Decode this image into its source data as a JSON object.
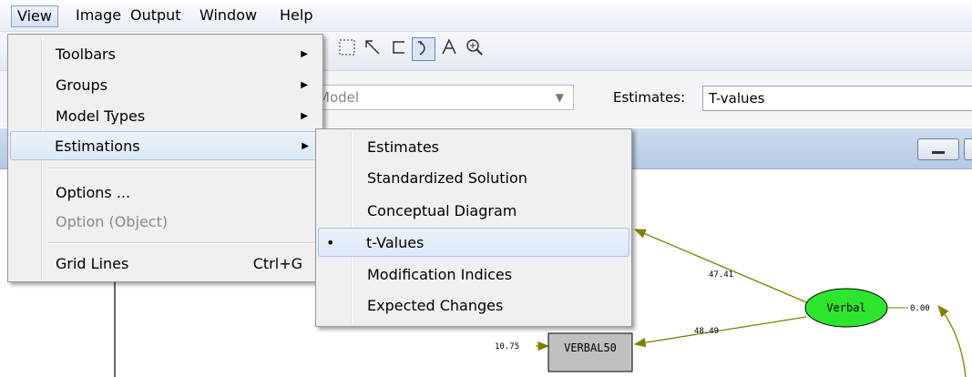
{
  "menubar": {
    "items": [
      "View",
      "Image",
      "Output",
      "Window",
      "Help"
    ]
  },
  "toolbar": {
    "icons": [
      "select-rectangle-icon",
      "arrow-tool-icon",
      "curved-arrow-tool-icon",
      "rotate-tool-icon",
      "text-tool-icon",
      "zoom-tool-icon"
    ]
  },
  "options": {
    "model_value": "Model",
    "estimates_label": "Estimates:",
    "estimates_value": "T-values"
  },
  "view_menu": {
    "items": [
      {
        "label": "Toolbars",
        "submenu": true
      },
      {
        "label": "Groups",
        "submenu": true
      },
      {
        "label": "Model Types",
        "submenu": true
      },
      {
        "label": "Estimations",
        "submenu": true,
        "highlighted": true
      },
      {
        "label": "Options ..."
      },
      {
        "label": "Option (Object)",
        "disabled": true
      },
      {
        "label": "Grid Lines",
        "shortcut": "Ctrl+G"
      }
    ],
    "arrow": "▶"
  },
  "estimations_menu": {
    "items": [
      {
        "label": "Estimates"
      },
      {
        "label": "Standardized Solution"
      },
      {
        "label": "Conceptual Diagram"
      },
      {
        "label": "t-Values",
        "checked": true,
        "highlighted": true
      },
      {
        "label": "Modification Indices"
      },
      {
        "label": "Expected Changes"
      }
    ],
    "bullet": "•"
  },
  "diagram": {
    "latent_name": "Verbal",
    "latent_color": "#2ee52e",
    "observed_name": "VERBAL50",
    "observed_color": "#c0c0c0",
    "arrow_color": "#808000",
    "t_value_top": "47.41",
    "t_value_observed": "48.49",
    "error_value": "10.75",
    "variance_value": "0.00"
  }
}
